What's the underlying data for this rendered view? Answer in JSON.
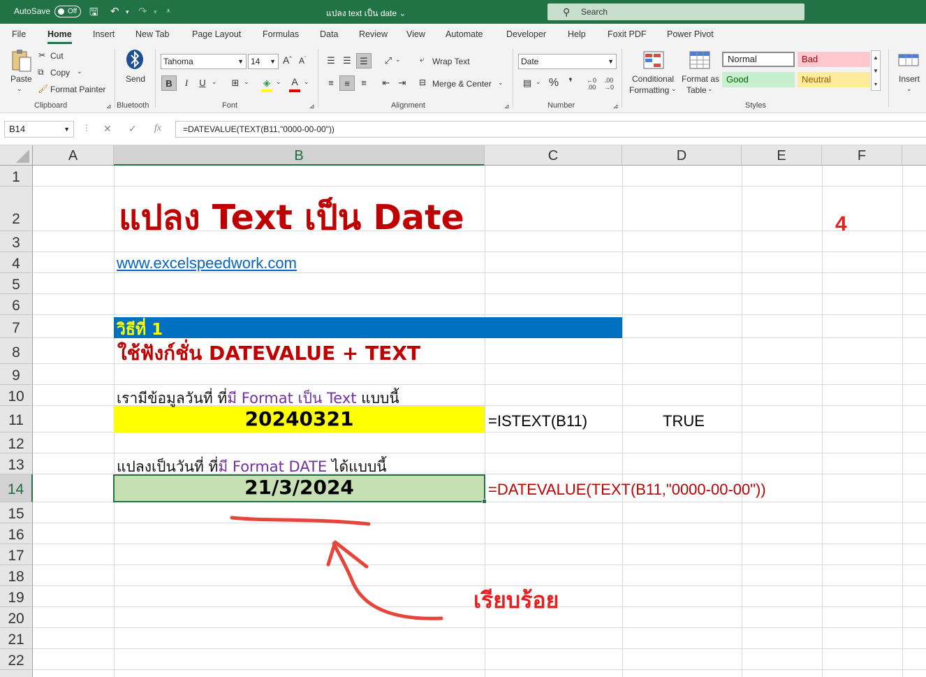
{
  "titlebar": {
    "autosave_label": "AutoSave",
    "autosave_state": "Off",
    "doc_title": "แปลง text เป็น date",
    "search_placeholder": "Search"
  },
  "tabs": [
    "File",
    "Home",
    "Insert",
    "New Tab",
    "Page Layout",
    "Formulas",
    "Data",
    "Review",
    "View",
    "Automate",
    "Developer",
    "Help",
    "Foxit PDF",
    "Power Pivot"
  ],
  "ribbon": {
    "clipboard": {
      "paste": "Paste",
      "cut": "Cut",
      "copy": "Copy",
      "format_painter": "Format Painter",
      "label": "Clipboard"
    },
    "bluetooth": {
      "send": "Send",
      "label": "Bluetooth"
    },
    "font": {
      "name": "Tahoma",
      "size": "14",
      "label": "Font"
    },
    "alignment": {
      "wrap_text": "Wrap Text",
      "merge_center": "Merge & Center",
      "label": "Alignment"
    },
    "number": {
      "format": "Date",
      "label": "Number"
    },
    "styles": {
      "conditional": "Conditional",
      "formatting": "Formatting",
      "format_as": "Format as",
      "table": "Table",
      "normal": "Normal",
      "bad": "Bad",
      "good": "Good",
      "neutral": "Neutral",
      "label": "Styles"
    },
    "cells": {
      "insert": "Insert"
    }
  },
  "formula_bar": {
    "name_box": "B14",
    "fx": "fx",
    "formula": "=DATEVALUE(TEXT(B11,\"0000-00-00\"))"
  },
  "columns": [
    "A",
    "B",
    "C",
    "D",
    "E",
    "F"
  ],
  "rows": [
    "1",
    "2",
    "3",
    "4",
    "5",
    "6",
    "7",
    "8",
    "9",
    "10",
    "11",
    "12",
    "13",
    "14",
    "15",
    "16",
    "17",
    "18",
    "19",
    "20",
    "21",
    "22"
  ],
  "sheet": {
    "title": "แปลง Text เป็น Date",
    "link": "www.excelspeedwork.com",
    "number_badge": "4",
    "method_header": "วิธีที่ 1",
    "method_desc": "ใช้ฟังก์ชั่น DATEVALUE + TEXT",
    "intro_1": {
      "a": "เรามีข้อมูลวันที่ ที่",
      "b": "มี Format เป็น Text",
      "c": " แบบนี้"
    },
    "text_value": "20240321",
    "istext_formula": "=ISTEXT(B11)",
    "istext_result": "TRUE",
    "intro_2": {
      "a": "แปลงเป็นวันที่ ที่",
      "b": "มี Format  DATE",
      "c": " ได้แบบนี้"
    },
    "date_value": "21/3/2024",
    "datevalue_formula": "=DATEVALUE(TEXT(B11,\"0000-00-00\"))",
    "done_label": "เรียบร้อย"
  },
  "colors": {
    "excel_green": "#217346",
    "red_text": "#c00000",
    "blue_band": "#0070c0",
    "yellow_text": "#ffff00",
    "yellow_fill": "#ffff00",
    "green_fill": "#c6e0b4",
    "purple_text": "#7030a0",
    "link_blue": "#0563c1",
    "annotation_red": "#e74c3c"
  }
}
